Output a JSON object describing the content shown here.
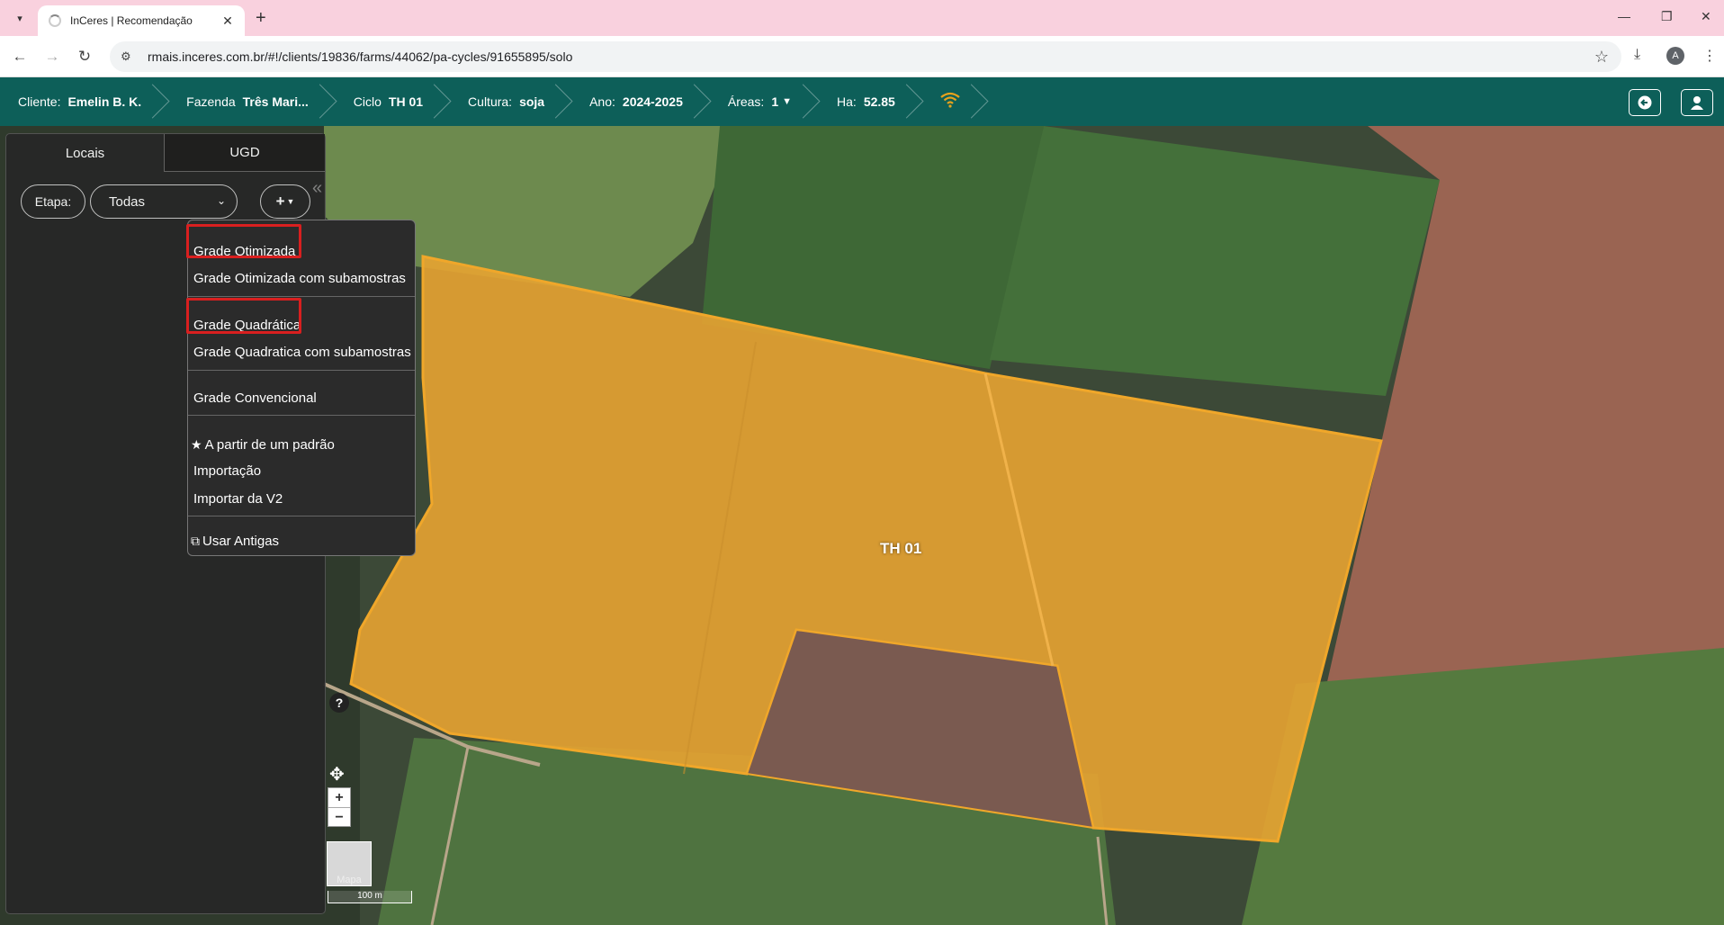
{
  "browser": {
    "tab_title": "InCeres | Recomendação",
    "url": "rmais.inceres.com.br/#!/clients/19836/farms/44062/pa-cycles/91655895/solo",
    "avatar_letter": "A"
  },
  "header": {
    "crumbs": [
      {
        "label": "Cliente:",
        "value": "Emelin B. K."
      },
      {
        "label": "Fazenda",
        "value": "Três Mari..."
      },
      {
        "label": "Ciclo",
        "value": "TH 01"
      },
      {
        "label": "Cultura:",
        "value": "soja"
      },
      {
        "label": "Ano:",
        "value": "2024-2025"
      },
      {
        "label": "Áreas:",
        "value": "1"
      },
      {
        "label": "Ha:",
        "value": "52.85"
      }
    ]
  },
  "panel": {
    "tabs": [
      "Locais",
      "UGD"
    ],
    "etapa_label": "Etapa:",
    "etapa_value": "Todas",
    "add_label": "+"
  },
  "dropdown": {
    "items": [
      "Grade Otimizada",
      "Grade Otimizada com subamostras",
      "Grade Quadrática",
      "Grade Quadratica com subamostras",
      "Grade Convencional",
      "A partir de um padrão",
      "Importação",
      "Importar da V2",
      "Usar Antigas"
    ]
  },
  "map": {
    "field_label": "TH 01",
    "help": "?",
    "zoom_in": "+",
    "zoom_out": "−",
    "layer_label": "Mapa",
    "scale_label": "100 m"
  },
  "colors": {
    "header_bg": "#0d5f59",
    "field_fill": "#e7a332",
    "highlight_red": "#d91f1f",
    "tabstrip_bg": "#f9d1de"
  }
}
